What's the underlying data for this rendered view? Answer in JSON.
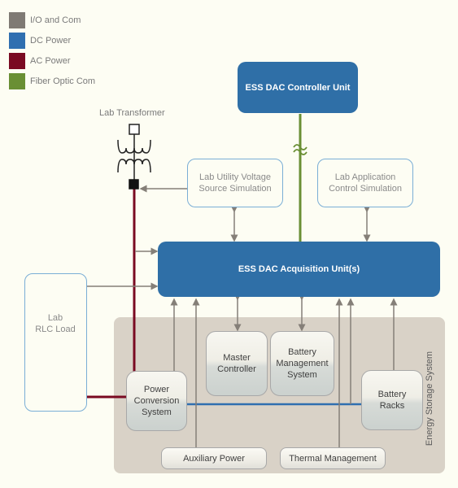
{
  "legend": [
    {
      "label": "I/O and Com",
      "color": "#7f7a74"
    },
    {
      "label": "DC Power",
      "color": "#2f6fb0"
    },
    {
      "label": "AC Power",
      "color": "#7a0a22"
    },
    {
      "label": "Fiber Optic Com",
      "color": "#6a8f34"
    }
  ],
  "nodes": {
    "controller": "ESS DAC Controller Unit",
    "acquisition": "ESS DAC Acquisition Unit(s)",
    "transformer": "Lab Transformer",
    "utility_sim_line1": "Lab Utility Voltage",
    "utility_sim_line2": "Source Simulation",
    "app_sim_line1": "Lab Application",
    "app_sim_line2": "Control Simulation",
    "rlc_line1": "Lab",
    "rlc_line2": "RLC Load",
    "master_line1": "Master",
    "master_line2": "Controller",
    "bms_line1": "Battery",
    "bms_line2": "Management",
    "bms_line3": "System",
    "pcs_line1": "Power",
    "pcs_line2": "Conversion",
    "pcs_line3": "System",
    "racks_line1": "Battery",
    "racks_line2": "Racks",
    "aux": "Auxiliary Power",
    "thermal": "Thermal Management",
    "ess_group": "Energy Storage System"
  }
}
